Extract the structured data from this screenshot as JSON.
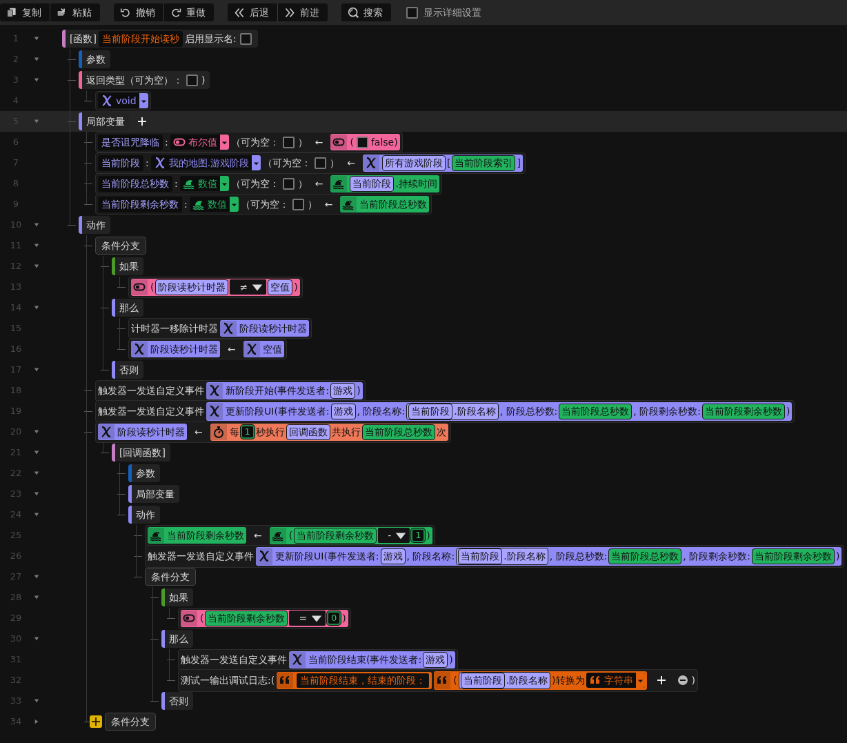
{
  "toolbar": {
    "groups": [
      {
        "buttons": [
          {
            "kind": "copy",
            "label": "复制"
          },
          {
            "kind": "paste",
            "label": "粘贴"
          }
        ]
      },
      {
        "buttons": [
          {
            "kind": "undo",
            "label": "撤销"
          },
          {
            "kind": "redo",
            "label": "重做"
          }
        ]
      },
      {
        "buttons": [
          {
            "kind": "back",
            "label": "后退"
          },
          {
            "kind": "forward",
            "label": "前进"
          }
        ]
      },
      {
        "buttons": [
          {
            "kind": "search",
            "label": "搜索"
          }
        ]
      }
    ],
    "option": {
      "label": "显示详细设置",
      "checked": false
    }
  },
  "tree": [
    {
      "num": "1",
      "expanded": true,
      "selected": false,
      "kind": "header",
      "color": "#c57ec3",
      "tokens": [
        {
          "kind": "text",
          "text": "[函数]"
        },
        {
          "kind": "title",
          "text": "当前阶段开始读秒"
        },
        {
          "kind": "text",
          "text": "启用显示名:"
        },
        {
          "kind": "checkbox",
          "checked": false
        }
      ],
      "children": [
        {
          "num": "2",
          "expanded": true,
          "selected": false,
          "kind": "header",
          "color": "#1560bd",
          "tokens": [
            {
              "kind": "text",
              "text": "参数"
            }
          ]
        },
        {
          "num": "3",
          "expanded": true,
          "selected": false,
          "kind": "header",
          "color": "#f2669c",
          "tokens": [
            {
              "kind": "text",
              "text": "返回类型（可为空）："
            },
            {
              "kind": "checkbox",
              "checked": false
            },
            {
              "kind": "text",
              "text": ")"
            }
          ],
          "children": [
            {
              "num": "4",
              "selected": false,
              "kind": "block",
              "tokens": [
                {
                  "kind": "entitytype",
                  "text": "void"
                }
              ]
            }
          ]
        },
        {
          "num": "5",
          "expanded": true,
          "selected": true,
          "kind": "header",
          "color": "#8f8af5",
          "tokens": [
            {
              "kind": "text",
              "text": "局部变量"
            }
          ],
          "trailing": [
            {
              "kind": "add",
              "filled": false
            }
          ],
          "children": [
            {
              "num": "6",
              "selected": false,
              "kind": "block",
              "tokens": [
                {
                  "kind": "name",
                  "text": "是否诅咒降临"
                },
                {
                  "kind": "text",
                  "text": ":"
                },
                {
                  "kind": "booltype",
                  "text": "布尔值"
                },
                {
                  "kind": "text",
                  "text": "（可为空："
                },
                {
                  "kind": "checkbox",
                  "checked": false
                },
                {
                  "kind": "text",
                  "text": "）"
                },
                {
                  "kind": "arrow",
                  "text": "←"
                },
                {
                  "kind": "boolean",
                  "parts": [
                    {
                      "kind": "text",
                      "text": "("
                    },
                    {
                      "kind": "checkbox",
                      "checked": false
                    },
                    {
                      "kind": "text",
                      "text": "false)"
                    }
                  ]
                }
              ]
            },
            {
              "num": "7",
              "selected": false,
              "kind": "block",
              "tokens": [
                {
                  "kind": "name",
                  "text": "当前阶段"
                },
                {
                  "kind": "text",
                  "text": ":"
                },
                {
                  "kind": "entitytype",
                  "text": "我的地图.游戏阶段"
                },
                {
                  "kind": "text",
                  "text": "（可为空："
                },
                {
                  "kind": "checkbox",
                  "checked": false
                },
                {
                  "kind": "text",
                  "text": "）"
                },
                {
                  "kind": "arrow",
                  "text": "←"
                },
                {
                  "kind": "entity",
                  "parts": [
                    {
                      "kind": "entityref",
                      "text": "所有游戏阶段"
                    },
                    {
                      "kind": "text",
                      "text": "["
                    },
                    {
                      "kind": "numberref",
                      "text": "当前阶段索引"
                    },
                    {
                      "kind": "text",
                      "text": "]"
                    }
                  ]
                }
              ]
            },
            {
              "num": "8",
              "selected": false,
              "kind": "block",
              "tokens": [
                {
                  "kind": "name",
                  "text": "当前阶段总秒数"
                },
                {
                  "kind": "text",
                  "text": ":"
                },
                {
                  "kind": "numbertype",
                  "text": "数值"
                },
                {
                  "kind": "text",
                  "text": "（可为空："
                },
                {
                  "kind": "checkbox",
                  "checked": false
                },
                {
                  "kind": "text",
                  "text": "）"
                },
                {
                  "kind": "arrow",
                  "text": "←"
                },
                {
                  "kind": "number",
                  "parts": [
                    {
                      "kind": "entityref",
                      "text": "当前阶段"
                    },
                    {
                      "kind": "text",
                      "text": ".持续时间"
                    }
                  ]
                }
              ]
            },
            {
              "num": "9",
              "selected": false,
              "kind": "block",
              "tokens": [
                {
                  "kind": "name",
                  "text": "当前阶段剩余秒数"
                },
                {
                  "kind": "text",
                  "text": ":"
                },
                {
                  "kind": "numbertype",
                  "text": "数值"
                },
                {
                  "kind": "text",
                  "text": "（可为空："
                },
                {
                  "kind": "checkbox",
                  "checked": false
                },
                {
                  "kind": "text",
                  "text": "）"
                },
                {
                  "kind": "arrow",
                  "text": "←"
                },
                {
                  "kind": "number",
                  "parts": [
                    {
                      "kind": "text",
                      "text": "当前阶段总秒数"
                    }
                  ]
                }
              ]
            }
          ]
        },
        {
          "num": "10",
          "expanded": true,
          "selected": false,
          "kind": "header",
          "color": "#8f8af5",
          "tokens": [
            {
              "kind": "text",
              "text": "动作"
            }
          ],
          "children": [
            {
              "num": "11",
              "expanded": true,
              "selected": false,
              "kind": "header",
              "tokens": [
                {
                  "kind": "text",
                  "text": "条件分支"
                }
              ],
              "children": [
                {
                  "num": "12",
                  "expanded": true,
                  "selected": false,
                  "kind": "header",
                  "color": "#4c9a2a",
                  "tokens": [
                    {
                      "kind": "text",
                      "text": "如果"
                    }
                  ],
                  "children": [
                    {
                      "num": "13",
                      "selected": false,
                      "kind": "block",
                      "tokens": [
                        {
                          "kind": "boolean",
                          "parts": [
                            {
                              "kind": "text",
                              "text": "("
                            },
                            {
                              "kind": "entityref",
                              "text": "阶段读秒计时器"
                            },
                            {
                              "kind": "op",
                              "text": "≠"
                            },
                            {
                              "kind": "entityref",
                              "text": "空值"
                            },
                            {
                              "kind": "text",
                              "text": ")"
                            }
                          ]
                        }
                      ]
                    }
                  ]
                },
                {
                  "num": "14",
                  "expanded": true,
                  "selected": false,
                  "kind": "header",
                  "color": "#8f8af5",
                  "tokens": [
                    {
                      "kind": "text",
                      "text": "那么"
                    }
                  ],
                  "children": [
                    {
                      "num": "15",
                      "selected": false,
                      "kind": "block",
                      "tokens": [
                        {
                          "kind": "text",
                          "text": "计时器一移除计时器"
                        },
                        {
                          "kind": "entity",
                          "parts": [
                            {
                              "kind": "text",
                              "text": "阶段读秒计时器"
                            }
                          ]
                        }
                      ]
                    },
                    {
                      "num": "16",
                      "selected": false,
                      "kind": "block",
                      "tokens": [
                        {
                          "kind": "entity",
                          "parts": [
                            {
                              "kind": "text",
                              "text": "阶段读秒计时器"
                            }
                          ]
                        },
                        {
                          "kind": "arrow",
                          "text": "←"
                        },
                        {
                          "kind": "entity",
                          "parts": [
                            {
                              "kind": "text",
                              "text": "空值"
                            }
                          ]
                        }
                      ]
                    }
                  ]
                },
                {
                  "num": "17",
                  "expanded": true,
                  "selected": false,
                  "kind": "header",
                  "color": "#8f8af5",
                  "tokens": [
                    {
                      "kind": "text",
                      "text": "否则"
                    }
                  ]
                }
              ]
            },
            {
              "num": "18",
              "selected": false,
              "kind": "block",
              "tokens": [
                {
                  "kind": "text",
                  "text": "触发器一发送自定义事件"
                },
                {
                  "kind": "entity",
                  "parts": [
                    {
                      "kind": "text",
                      "text": "新阶段开始(事件发送者:"
                    },
                    {
                      "kind": "entityref",
                      "text": "游戏"
                    },
                    {
                      "kind": "text",
                      "text": ")"
                    }
                  ]
                }
              ]
            },
            {
              "num": "19",
              "selected": false,
              "kind": "block",
              "tokens": [
                {
                  "kind": "text",
                  "text": "触发器一发送自定义事件"
                },
                {
                  "kind": "entity",
                  "parts": [
                    {
                      "kind": "text",
                      "text": "更新阶段UI(事件发送者:"
                    },
                    {
                      "kind": "entityref",
                      "text": "游戏"
                    },
                    {
                      "kind": "text",
                      "text": ", 阶段名称:"
                    },
                    {
                      "kind": "entityref",
                      "parts": [
                        {
                          "kind": "entityref",
                          "text": "当前阶段"
                        },
                        {
                          "kind": "text",
                          "text": ".阶段名称"
                        }
                      ]
                    },
                    {
                      "kind": "text",
                      "text": ", 阶段总秒数:"
                    },
                    {
                      "kind": "numberref",
                      "text": "当前阶段总秒数"
                    },
                    {
                      "kind": "text",
                      "text": ", 阶段剩余秒数:"
                    },
                    {
                      "kind": "numberref",
                      "text": "当前阶段剩余秒数"
                    },
                    {
                      "kind": "text",
                      "text": ")"
                    }
                  ]
                }
              ]
            },
            {
              "num": "20",
              "expanded": true,
              "selected": false,
              "kind": "block",
              "tokens": [
                {
                  "kind": "entity",
                  "parts": [
                    {
                      "kind": "text",
                      "text": "阶段读秒计时器"
                    }
                  ]
                },
                {
                  "kind": "arrow",
                  "text": "←"
                },
                {
                  "kind": "timer",
                  "parts": [
                    {
                      "kind": "text",
                      "text": "每"
                    },
                    {
                      "kind": "lit",
                      "text": "1"
                    },
                    {
                      "kind": "text",
                      "text": "秒执行"
                    },
                    {
                      "kind": "entityref",
                      "text": "回调函数"
                    },
                    {
                      "kind": "text",
                      "text": "共执行"
                    },
                    {
                      "kind": "numberref",
                      "text": "当前阶段总秒数"
                    },
                    {
                      "kind": "text",
                      "text": "次"
                    }
                  ]
                }
              ],
              "children": [
                {
                  "num": "21",
                  "expanded": true,
                  "selected": false,
                  "kind": "header",
                  "color": "#c57ec3",
                  "tokens": [
                    {
                      "kind": "text",
                      "text": "[回调函数]"
                    }
                  ],
                  "children": [
                    {
                      "num": "22",
                      "expanded": true,
                      "selected": false,
                      "kind": "header",
                      "color": "#1560bd",
                      "tokens": [
                        {
                          "kind": "text",
                          "text": "参数"
                        }
                      ]
                    },
                    {
                      "num": "23",
                      "expanded": true,
                      "selected": false,
                      "kind": "header",
                      "color": "#8f8af5",
                      "tokens": [
                        {
                          "kind": "text",
                          "text": "局部变量"
                        }
                      ]
                    },
                    {
                      "num": "24",
                      "expanded": true,
                      "selected": false,
                      "kind": "header",
                      "color": "#8f8af5",
                      "tokens": [
                        {
                          "kind": "text",
                          "text": "动作"
                        }
                      ],
                      "children": [
                        {
                          "num": "25",
                          "selected": false,
                          "kind": "block",
                          "tokens": [
                            {
                              "kind": "number",
                              "parts": [
                                {
                                  "kind": "text",
                                  "text": "当前阶段剩余秒数"
                                }
                              ]
                            },
                            {
                              "kind": "arrow",
                              "text": "←"
                            },
                            {
                              "kind": "number",
                              "parts": [
                                {
                                  "kind": "text",
                                  "text": "("
                                },
                                {
                                  "kind": "numberref",
                                  "text": "当前阶段剩余秒数"
                                },
                                {
                                  "kind": "op",
                                  "text": "-"
                                },
                                {
                                  "kind": "lit",
                                  "text": "1"
                                },
                                {
                                  "kind": "text",
                                  "text": ")"
                                }
                              ]
                            }
                          ]
                        },
                        {
                          "num": "26",
                          "selected": false,
                          "kind": "block",
                          "tokens": [
                            {
                              "kind": "text",
                              "text": "触发器一发送自定义事件"
                            },
                            {
                              "kind": "entity",
                              "parts": [
                                {
                                  "kind": "text",
                                  "text": "更新阶段UI(事件发送者:"
                                },
                                {
                                  "kind": "entityref",
                                  "text": "游戏"
                                },
                                {
                                  "kind": "text",
                                  "text": ", 阶段名称:"
                                },
                                {
                                  "kind": "entityref",
                                  "parts": [
                                    {
                                      "kind": "entityref",
                                      "text": "当前阶段"
                                    },
                                    {
                                      "kind": "text",
                                      "text": ".阶段名称"
                                    }
                                  ]
                                },
                                {
                                  "kind": "text",
                                  "text": ", 阶段总秒数:"
                                },
                                {
                                  "kind": "numberref",
                                  "text": "当前阶段总秒数"
                                },
                                {
                                  "kind": "text",
                                  "text": ", 阶段剩余秒数:"
                                },
                                {
                                  "kind": "numberref",
                                  "text": "当前阶段剩余秒数"
                                },
                                {
                                  "kind": "text",
                                  "text": ")"
                                }
                              ]
                            }
                          ]
                        },
                        {
                          "num": "27",
                          "expanded": true,
                          "selected": false,
                          "kind": "header",
                          "tokens": [
                            {
                              "kind": "text",
                              "text": "条件分支"
                            }
                          ],
                          "children": [
                            {
                              "num": "28",
                              "expanded": true,
                              "selected": false,
                              "kind": "header",
                              "color": "#4c9a2a",
                              "tokens": [
                                {
                                  "kind": "text",
                                  "text": "如果"
                                }
                              ],
                              "children": [
                                {
                                  "num": "29",
                                  "selected": false,
                                  "kind": "block",
                                  "tokens": [
                                    {
                                      "kind": "boolean",
                                      "parts": [
                                        {
                                          "kind": "text",
                                          "text": "("
                                        },
                                        {
                                          "kind": "numberref",
                                          "text": "当前阶段剩余秒数"
                                        },
                                        {
                                          "kind": "op",
                                          "text": "="
                                        },
                                        {
                                          "kind": "lit",
                                          "text": "0"
                                        },
                                        {
                                          "kind": "text",
                                          "text": ")"
                                        }
                                      ]
                                    }
                                  ]
                                }
                              ]
                            },
                            {
                              "num": "30",
                              "expanded": true,
                              "selected": false,
                              "kind": "header",
                              "color": "#8f8af5",
                              "tokens": [
                                {
                                  "kind": "text",
                                  "text": "那么"
                                }
                              ],
                              "children": [
                                {
                                  "num": "31",
                                  "selected": false,
                                  "kind": "block",
                                  "tokens": [
                                    {
                                      "kind": "text",
                                      "text": "触发器一发送自定义事件"
                                    },
                                    {
                                      "kind": "entity",
                                      "parts": [
                                        {
                                          "kind": "text",
                                          "text": "当前阶段结束(事件发送者:"
                                        },
                                        {
                                          "kind": "entityref",
                                          "text": "游戏"
                                        },
                                        {
                                          "kind": "text",
                                          "text": ")"
                                        }
                                      ]
                                    }
                                  ]
                                },
                                {
                                  "num": "32",
                                  "selected": false,
                                  "kind": "block",
                                  "tokens": [
                                    {
                                      "kind": "text",
                                      "text": "测试一输出调试日志:("
                                    },
                                    {
                                      "kind": "string",
                                      "parts": [
                                        {
                                          "kind": "str",
                                          "text": "当前阶段结束，结束的阶段："
                                        }
                                      ]
                                    },
                                    {
                                      "kind": "string",
                                      "parts": [
                                        {
                                          "kind": "text",
                                          "text": "("
                                        },
                                        {
                                          "kind": "entityref",
                                          "parts": [
                                            {
                                              "kind": "entityref",
                                              "text": "当前阶段"
                                            },
                                            {
                                              "kind": "text",
                                              "text": ".阶段名称"
                                            }
                                          ]
                                        },
                                        {
                                          "kind": "text",
                                          "text": ")转换为"
                                        },
                                        {
                                          "kind": "stringtype",
                                          "text": "字符串"
                                        }
                                      ]
                                    },
                                    {
                                      "kind": "add",
                                      "filled": false
                                    },
                                    {
                                      "kind": "remove"
                                    },
                                    {
                                      "kind": "text",
                                      "text": ")"
                                    }
                                  ]
                                }
                              ]
                            },
                            {
                              "num": "33",
                              "expanded": true,
                              "selected": false,
                              "kind": "header",
                              "color": "#8f8af5",
                              "tokens": [
                                {
                                  "kind": "text",
                                  "text": "否则"
                                }
                              ]
                            }
                          ]
                        }
                      ]
                    }
                  ]
                }
              ]
            },
            {
              "num": "34",
              "expanded": false,
              "selected": false,
              "kind": "header",
              "leading": [
                {
                  "kind": "add",
                  "filled": true
                }
              ],
              "tokens": [
                {
                  "kind": "text",
                  "text": "条件分支"
                }
              ]
            }
          ]
        }
      ]
    }
  ]
}
